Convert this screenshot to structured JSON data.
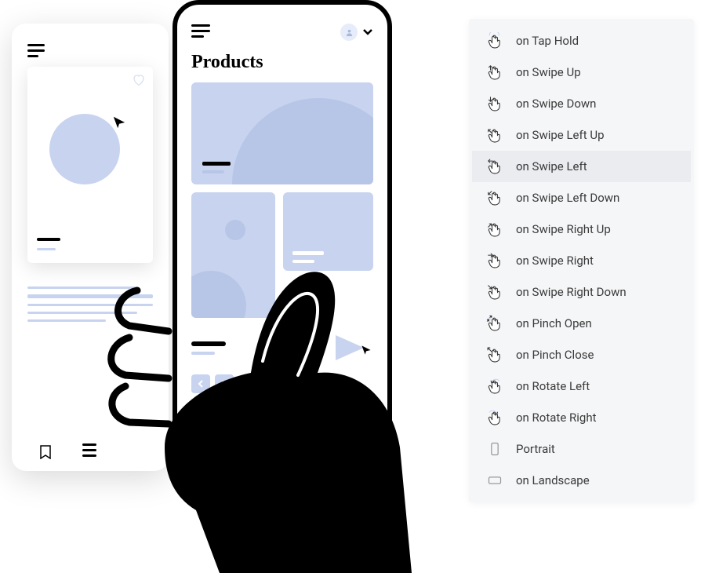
{
  "front_phone": {
    "title": "Products"
  },
  "events": {
    "items": [
      {
        "label": "on Tap Hold",
        "icon": "tap-hold",
        "selected": false
      },
      {
        "label": "on Swipe Up",
        "icon": "swipe-up",
        "selected": false
      },
      {
        "label": "on Swipe Down",
        "icon": "swipe-down",
        "selected": false
      },
      {
        "label": "on Swipe Left Up",
        "icon": "swipe-left-up",
        "selected": false
      },
      {
        "label": "on Swipe Left",
        "icon": "swipe-left",
        "selected": true
      },
      {
        "label": "on Swipe Left Down",
        "icon": "swipe-left-down",
        "selected": false
      },
      {
        "label": "on Swipe Right Up",
        "icon": "swipe-right-up",
        "selected": false
      },
      {
        "label": "on Swipe Right",
        "icon": "swipe-right",
        "selected": false
      },
      {
        "label": "on Swipe Right Down",
        "icon": "swipe-right-down",
        "selected": false
      },
      {
        "label": "on Pinch Open",
        "icon": "pinch-open",
        "selected": false
      },
      {
        "label": "on Pinch Close",
        "icon": "pinch-close",
        "selected": false
      },
      {
        "label": "on Rotate Left",
        "icon": "rotate-left",
        "selected": false
      },
      {
        "label": "on Rotate Right",
        "icon": "rotate-right",
        "selected": false
      },
      {
        "label": "Portrait",
        "icon": "portrait",
        "selected": false
      },
      {
        "label": "on Landscape",
        "icon": "landscape",
        "selected": false
      }
    ]
  }
}
